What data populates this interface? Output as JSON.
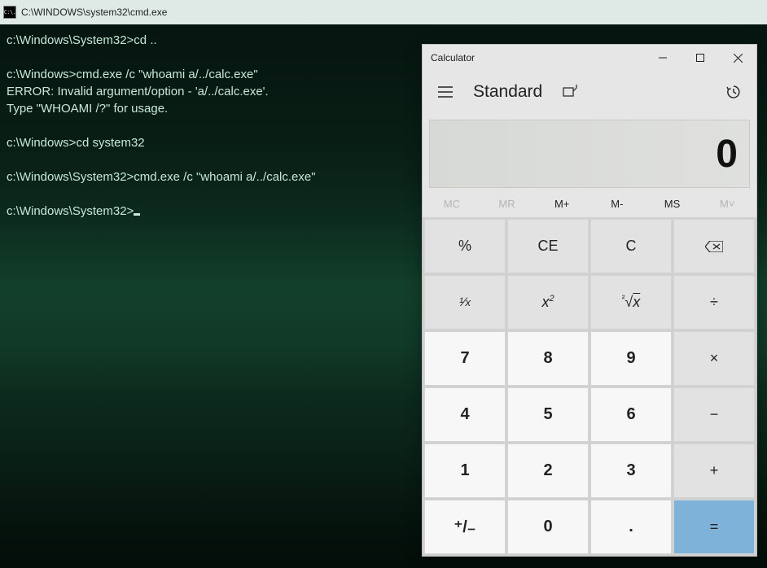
{
  "cmd": {
    "icon_text": "C:\\.",
    "title": "C:\\WINDOWS\\system32\\cmd.exe",
    "lines": [
      "c:\\Windows\\System32>cd ..",
      "",
      "c:\\Windows>cmd.exe /c \"whoami a/../calc.exe\"",
      "ERROR: Invalid argument/option - 'a/../calc.exe'.",
      "Type \"WHOAMI /?\" for usage.",
      "",
      "c:\\Windows>cd system32",
      "",
      "c:\\Windows\\System32>cmd.exe /c \"whoami a/../calc.exe\"",
      ""
    ],
    "prompt": "c:\\Windows\\System32>"
  },
  "calc": {
    "title": "Calculator",
    "mode": "Standard",
    "display": "0",
    "memory": {
      "mc": "MC",
      "mr": "MR",
      "mplus": "M+",
      "mminus": "M-",
      "ms": "MS",
      "mlist": "M˅"
    },
    "keys": {
      "percent": "%",
      "ce": "CE",
      "c": "C",
      "backspace": "⌫",
      "reciprocal": "¹/ₓ",
      "square_base": "x",
      "square_exp": "2",
      "root_pre": "²",
      "root_rad": "√",
      "root_x": "x",
      "divide": "÷",
      "n7": "7",
      "n8": "8",
      "n9": "9",
      "multiply": "×",
      "n4": "4",
      "n5": "5",
      "n6": "6",
      "minus": "−",
      "n1": "1",
      "n2": "2",
      "n3": "3",
      "plus": "+",
      "negate": "⁺/₋",
      "n0": "0",
      "dot": ".",
      "equals": "="
    }
  }
}
